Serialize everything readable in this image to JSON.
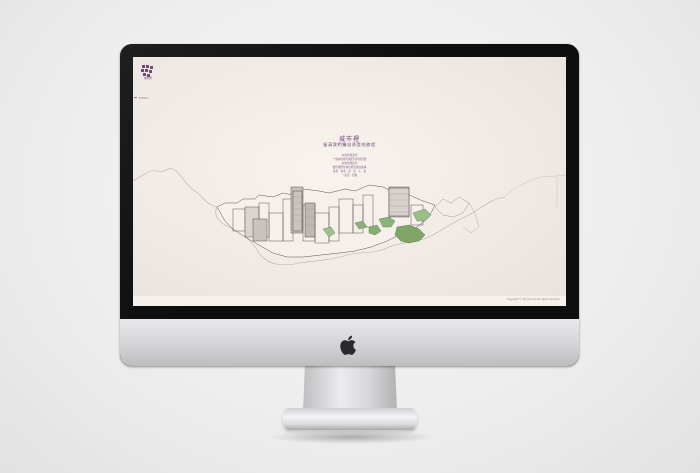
{
  "site": {
    "logo_text": "城市裡",
    "menu_label": "MENU",
    "title": "城市裡",
    "subtitle": "留滿我們獨自承受的旅程",
    "body_lines": [
      "在城市裡漫步",
      "一個城市裡有我們共同的回憶",
      "在城市裡找尋",
      "屬於我們在城市裡流連的故事",
      "春夏 · 秋冬 · 晨 · 昏 · 午 · 夜",
      "一起走 · 回來"
    ],
    "copyright": "Copyright © City Journey All rights reserved."
  },
  "colors": {
    "accent": "#6b3d6f",
    "background": "#f3ece6",
    "bezel": "#0e0e0e"
  },
  "icons": [
    "apple-logo-icon",
    "menu-icon",
    "brand-logo-icon"
  ]
}
